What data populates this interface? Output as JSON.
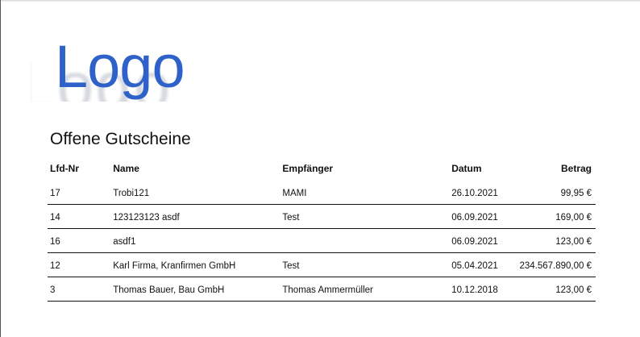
{
  "logo": {
    "text": "Logo",
    "shadow_text": "Logo"
  },
  "document": {
    "title": "Offene Gutscheine"
  },
  "table": {
    "headers": {
      "nr": "Lfd-Nr",
      "name": "Name",
      "recipient": "Empfänger",
      "date": "Datum",
      "amount": "Betrag"
    },
    "rows": [
      {
        "nr": "17",
        "name": "Trobi121",
        "recipient": "MAMI",
        "date": "26.10.2021",
        "amount": "99,95 €"
      },
      {
        "nr": "14",
        "name": "123123123 asdf",
        "recipient": "Test",
        "date": "06.09.2021",
        "amount": "169,00 €"
      },
      {
        "nr": "16",
        "name": "asdf1",
        "recipient": "",
        "date": "06.09.2021",
        "amount": "123,00 €"
      },
      {
        "nr": "12",
        "name": "Karl Firma, Kranfirmen GmbH",
        "recipient": "Test",
        "date": "05.04.2021",
        "amount": "234.567.890,00 €"
      },
      {
        "nr": "3",
        "name": "Thomas Bauer, Bau GmbH",
        "recipient": "Thomas Ammermüller",
        "date": "10.12.2018",
        "amount": "123,00 €"
      }
    ]
  },
  "colors": {
    "logo": "#2f62c9",
    "text": "#111111"
  }
}
